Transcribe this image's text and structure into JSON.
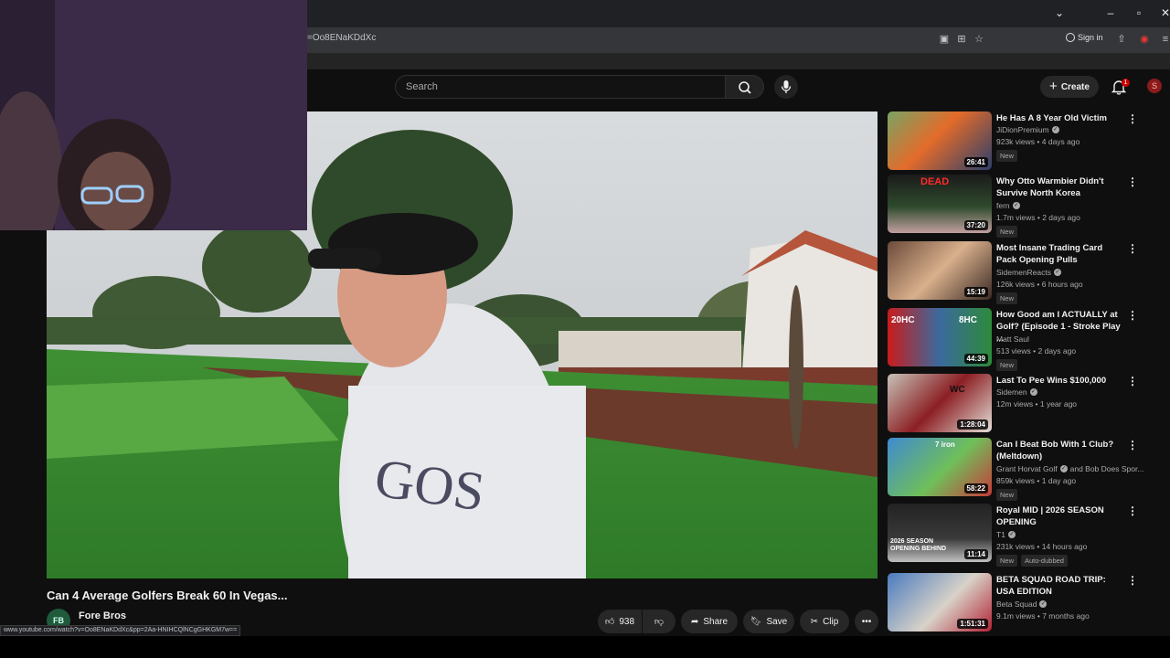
{
  "browser": {
    "url": "=Oo8ENaKDdXc",
    "sign_in_label": "Sign in",
    "status_url": "www.youtube.com/watch?v=Oo8ENaKDdXc&pp=2Aa-HNIHCQlNCgGHKGM7w=="
  },
  "header": {
    "search_placeholder": "Search",
    "create_label": "Create",
    "notification_count": "1"
  },
  "video": {
    "title": "Can 4 Average Golfers Break 60 In Vegas...",
    "channel": "Fore Bros",
    "likes": "938",
    "share_label": "Share",
    "save_label": "Save",
    "clip_label": "Clip"
  },
  "recommendations": [
    {
      "title": "He Has A 8 Year Old Victim",
      "channel": "JiDionPremium",
      "verified": true,
      "meta": "923k views • 4 days ago",
      "badge": "New",
      "duration": "26:41"
    },
    {
      "title": "Why Otto Warmbier Didn't Survive North Korea",
      "channel": "fern",
      "verified": true,
      "meta": "1.7m views • 2 days ago",
      "badge": "New",
      "duration": "37:20"
    },
    {
      "title": "Most Insane Trading Card Pack Opening Pulls",
      "channel": "SidemenReacts",
      "verified": true,
      "meta": "126k views • 6 hours ago",
      "badge": "New",
      "duration": "15:19"
    },
    {
      "title": "How Good am I ACTUALLY at Golf? (Episode 1 - Stroke Play ...",
      "channel": "Matt Saul",
      "verified": false,
      "meta": "513 views • 2 days ago",
      "badge": "New",
      "duration": "44:39"
    },
    {
      "title": "Last To Pee Wins $100,000",
      "channel": "Sidemen",
      "verified": true,
      "meta": "12m views • 1 year ago",
      "badge": "",
      "duration": "1:28:04"
    },
    {
      "title": "Can I Beat Bob With 1 Club? (Meltdown)",
      "channel": "Grant Horvat Golf",
      "verified": true,
      "channel_extra": "and Bob Does Spor...",
      "meta": "859k views • 1 day ago",
      "badge": "New",
      "duration": "58:22"
    },
    {
      "title": "Royal MID | 2026 SEASON OPENING",
      "channel": "T1",
      "verified": true,
      "meta": "231k views • 14 hours ago",
      "badge": "New",
      "badge2": "Auto-dubbed",
      "duration": "11:14"
    },
    {
      "title": "BETA SQUAD ROAD TRIP: USA EDITION",
      "channel": "Beta Squad",
      "verified": true,
      "meta": "9.1m views • 7 months ago",
      "badge": "",
      "duration": "1:51:31"
    }
  ],
  "thumb_text": {
    "r2_banner": "DEAD",
    "r4_left": "20HC",
    "r4_right": "8HC",
    "r5_tag": "WC",
    "r6_tag": "7 iron",
    "r7_overlay": "2026 SEASON OPENING BEHIND"
  },
  "colors": {
    "accent": "#ff0000",
    "background": "#0f0f0f"
  }
}
